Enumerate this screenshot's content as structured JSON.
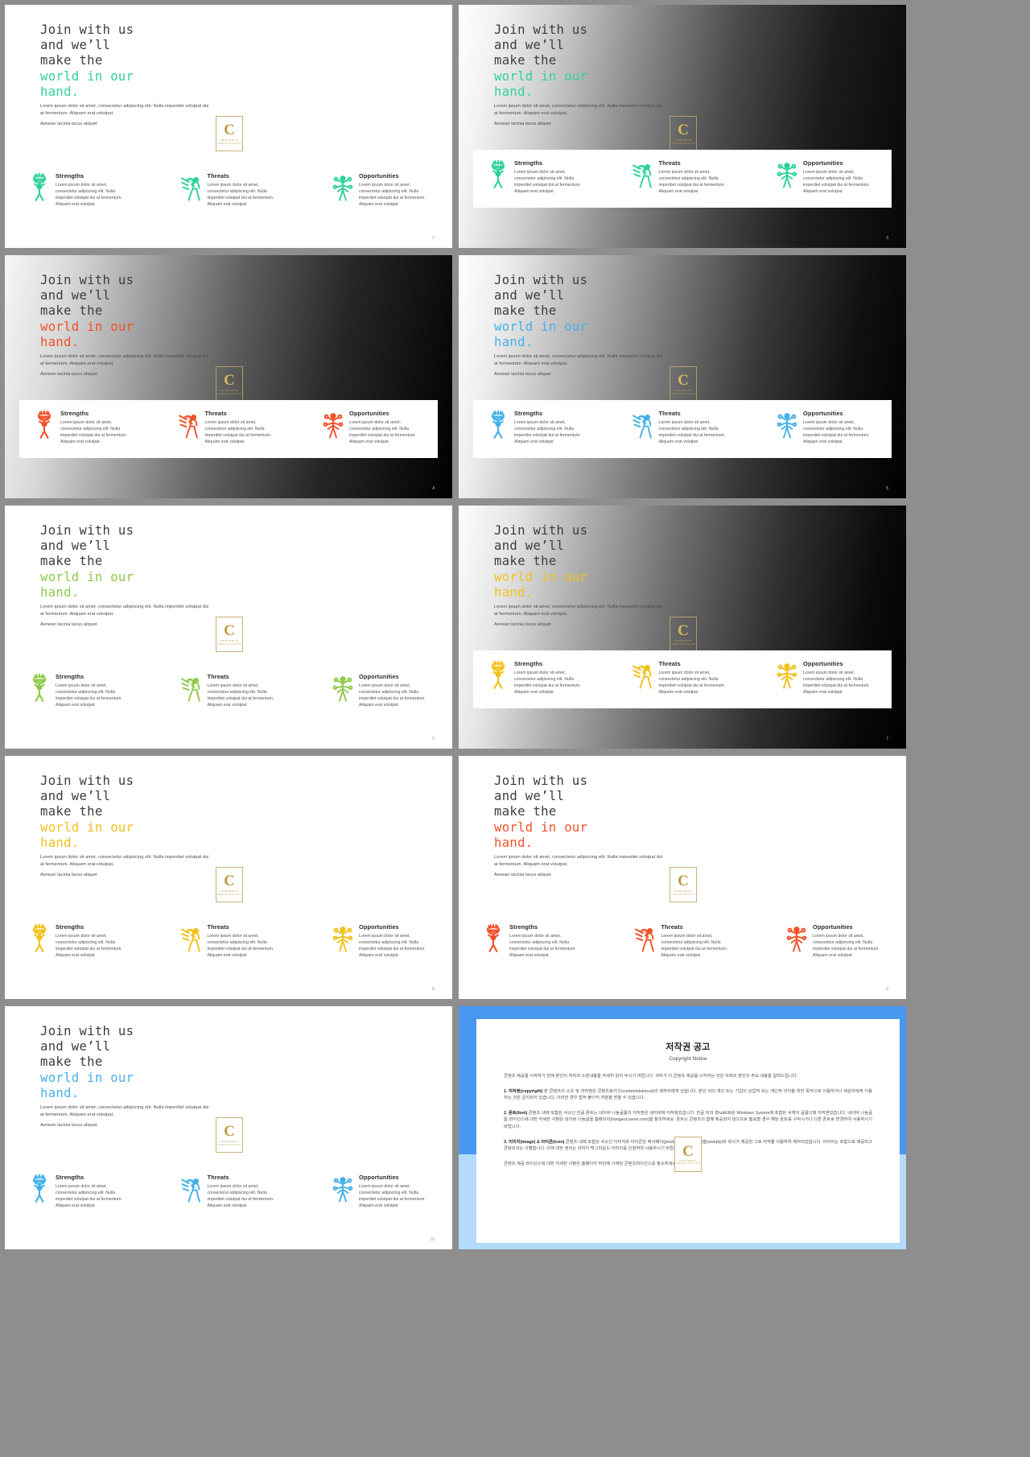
{
  "headline": {
    "line1": "Join with us",
    "line2": "and we’ll",
    "line3": "make the",
    "accent1": "world in our",
    "accent2": "hand."
  },
  "lede": {
    "p1": "Lorem ipsum dolor sit amet, consectetur adipiscing elit. Nulla imperdiet volutpat dui at fermentum. Aliquam erat volutpat.",
    "p2": "Aenean lacinia lacus aliquet"
  },
  "logo": {
    "letter": "C",
    "name": "CONTENTS",
    "sub": "PREMIUM TEMPLATE"
  },
  "swot": {
    "items": [
      {
        "icon": "strengths-trophy-icon",
        "title": "Strengths",
        "desc": "Lorem ipsum dolor sit amet, consectetur adipiscing elit. Nulla imperdiet volutpat dui at fermentum. Aliquam erat volutpat"
      },
      {
        "icon": "threats-javelin-icon",
        "title": "Threats",
        "desc": "Lorem ipsum dolor sit amet, consectetur adipiscing elit. Nulla imperdiet volutpat dui at fermentum. Aliquam erat volutpat"
      },
      {
        "icon": "opportunities-multitask-icon",
        "title": "Opportunities",
        "desc": "Lorem ipsum dolor sit amet, consectetur adipiscing elit. Nulla imperdiet volutpat dui at fermentum. Aliquam erat volutpat"
      }
    ]
  },
  "slides": [
    {
      "number": "2",
      "accent": "#2fd19a",
      "bg": "white",
      "panel": false
    },
    {
      "number": "3",
      "accent": "#2fd19a",
      "bg": "dark",
      "panel": true
    },
    {
      "number": "4",
      "accent": "#f2502a",
      "bg": "dark2",
      "panel": true
    },
    {
      "number": "5",
      "accent": "#45b0e8",
      "bg": "dark3",
      "panel": true
    },
    {
      "number": "6",
      "accent": "#8fc94a",
      "bg": "white",
      "panel": false
    },
    {
      "number": "7",
      "accent": "#f2c019",
      "bg": "dark4",
      "panel": true
    },
    {
      "number": "8",
      "accent": "#f2c019",
      "bg": "white",
      "panel": false
    },
    {
      "number": "9",
      "accent": "#f2502a",
      "bg": "white",
      "panel": false
    },
    {
      "number": "10",
      "accent": "#45b0e8",
      "bg": "white",
      "panel": false
    }
  ],
  "copyright": {
    "title": "저작권 공고",
    "subtitle": "Copyright Notice",
    "intro": "콘텐츠 제공을 시작하기 전에 본인의 허락과 소장내용을 자세히 읽어 주시기 바랍니다. 귀하가 이 콘텐츠 제공을 시작하는 것은 아래의 본인의 주요 내용을 알려드립니다.",
    "items": [
      {
        "label": "1. 저작권(copyright)",
        "body": " 본 콘텐츠의 소유 및 저작권은 콘텐츠토키즈(contentstokeout)의 제작자에게 있습니다. 본인 외의 개인 또는 기업이 상업적 또는 개인적 이익을 위한 목적으로 이용하거나 제삼자에게 이용하는 것은 금지되어 있습니다. 이러한 경우 법적 불이익 처분을 받을 수 있습니다."
      },
      {
        "label": "2. 폰트(font)",
        "body": " 콘텐츠 내에 포함된 서소인 한글 폰트는 네이버 나눔글꼴의 저작권은 네이버에 저작권있습니다. 한글 외의 영\\ubb38은 Windows System에 포함된 서체의 글꼴으에 저작권있습니다. 네이버 나눔글꼴 라이선스에 대한 자세한 사항은 네이버 나눔글꼴 홈페이지(hangeul.naver.com)을 참조하세요. 폰트는 콘텐츠의 함께 제공되지 않으므로 필요할 경우 해당 폰트를 구하시거나 다른 폰트로 변경하여 사용하시기 바랍니다."
      },
      {
        "label": "3. 이미지(image) & 아이콘(icon)",
        "body": " 콘텐츠 내에 포함된 서소인 이미지와 아이콘은 픽사베이(pixabay.com)와 웹입을(webply)와 회사가 제공한 그로 저작물 이용하여 제작되었습니다. 아이지는 포함으로 제공되고 콘텐츠의는 구별합니다. 이에 대한 권리는 귀하가 백그라운드 이미지를 인정하여 사용하시기 바랍니다."
      }
    ],
    "footer": "콘텐츠 제공 라이선스에 대한 자세한 사항은 홈페이지 하단에 기재된 콘텐츠라이선스를 참소하세요."
  }
}
